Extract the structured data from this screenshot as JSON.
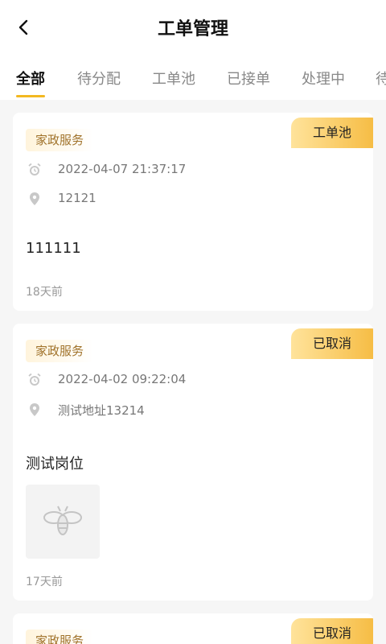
{
  "header": {
    "title": "工单管理",
    "back_icon": "chevron-left-icon"
  },
  "tabs": [
    {
      "label": "全部",
      "active": true
    },
    {
      "label": "待分配",
      "active": false
    },
    {
      "label": "工单池",
      "active": false
    },
    {
      "label": "已接单",
      "active": false
    },
    {
      "label": "处理中",
      "active": false
    },
    {
      "label": "待",
      "active": false
    }
  ],
  "colors": {
    "accent": "#f3b821",
    "status_gradient_start": "#ffe39b",
    "status_gradient_end": "#f6bd45",
    "category_text": "#a0722a"
  },
  "orders": [
    {
      "category": "家政服务",
      "status": "工单池",
      "datetime": "2022-04-07 21:37:17",
      "address": "12121",
      "description": "111111",
      "ago": "18天前",
      "has_image": false
    },
    {
      "category": "家政服务",
      "status": "已取消",
      "datetime": "2022-04-02 09:22:04",
      "address": "测试地址13214",
      "description": "测试岗位",
      "ago": "17天前",
      "has_image": true
    },
    {
      "category": "家政服务",
      "status": "已取消"
    }
  ]
}
